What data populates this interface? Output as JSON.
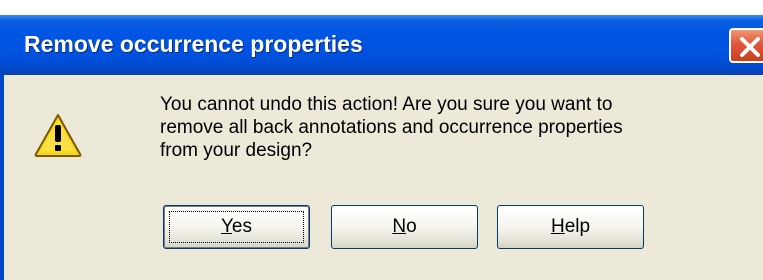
{
  "dialog": {
    "title": "Remove occurrence properties",
    "icon": "warning-icon",
    "message_lines": [
      "You cannot undo this action!  Are you sure you want to",
      "remove all back annotations and occurrence properties",
      "from your design?"
    ],
    "buttons": {
      "yes": {
        "mnemonic": "Y",
        "rest": "es"
      },
      "no": {
        "mnemonic": "N",
        "rest": "o"
      },
      "help": {
        "mnemonic": "H",
        "rest": "elp"
      }
    },
    "default_button": "yes"
  },
  "colors": {
    "titlebar": "#0054e3",
    "dialog_bg": "#ece9d8",
    "close_button": "#e2553a",
    "warning_fill": "#f8d81c"
  }
}
